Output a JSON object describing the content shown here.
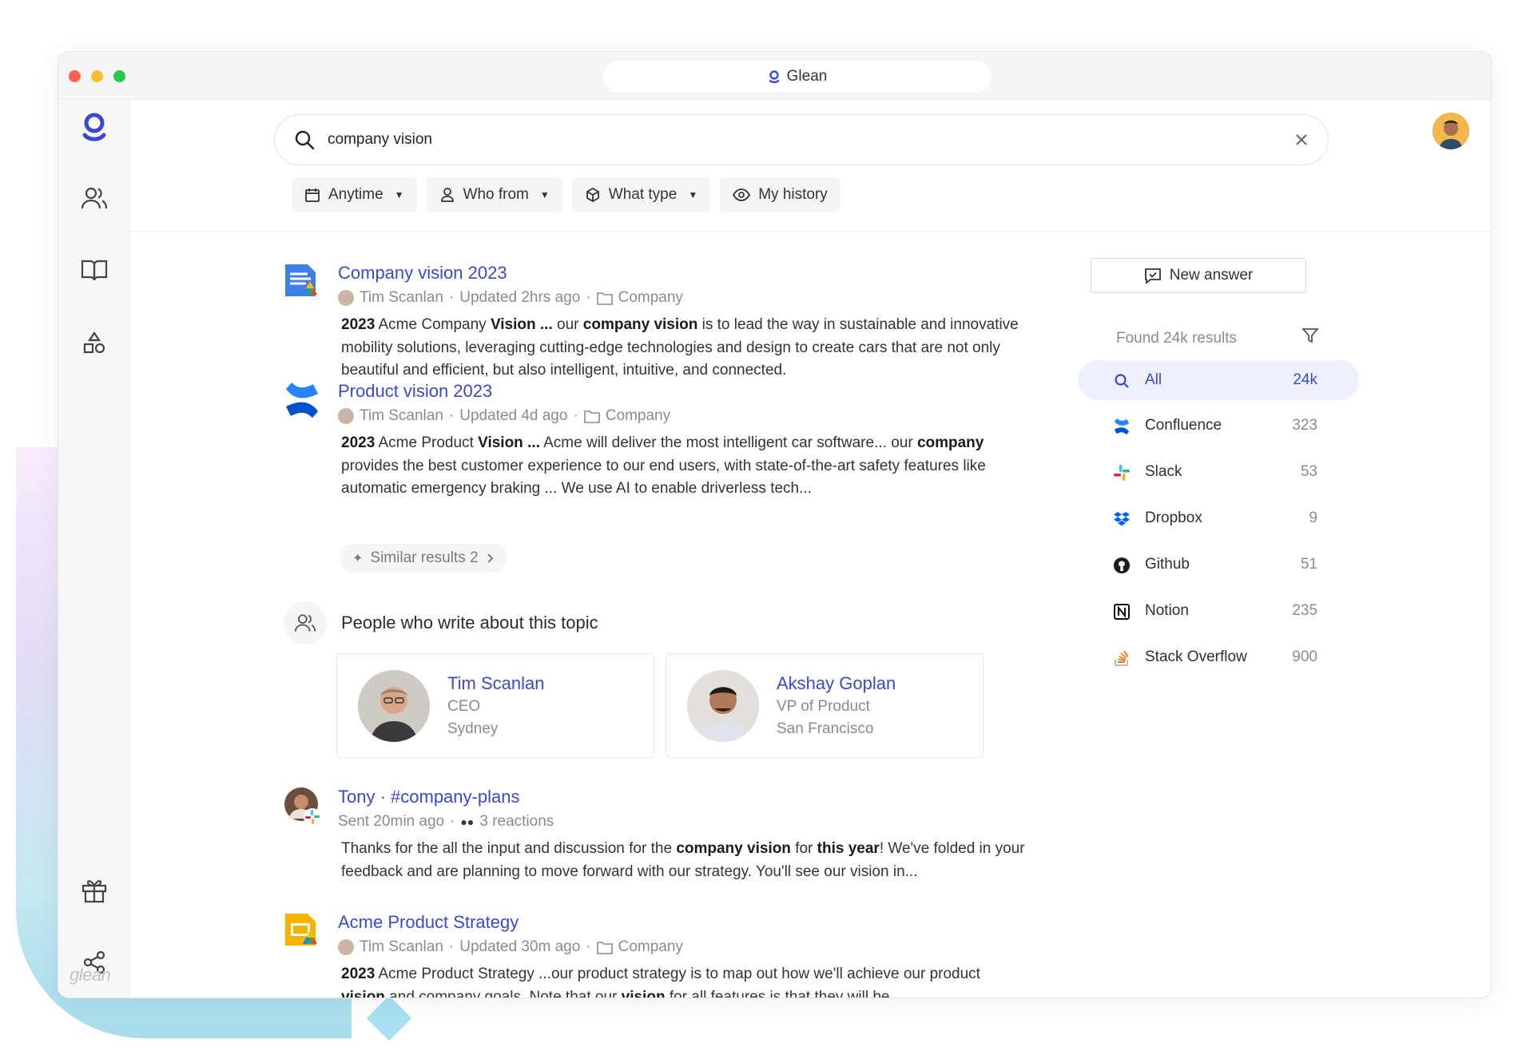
{
  "window": {
    "title": "Glean"
  },
  "rail": {
    "wordmark": "glean"
  },
  "search": {
    "query": "company vision"
  },
  "filters": [
    {
      "label": "Anytime",
      "icon": "calendar-icon"
    },
    {
      "label": "Who from",
      "icon": "person-icon"
    },
    {
      "label": "What type",
      "icon": "cube-icon"
    },
    {
      "label": "My history",
      "icon": "eye-icon"
    }
  ],
  "results": [
    {
      "title": "Company vision 2023",
      "author": "Tim Scanlan",
      "sep": "·",
      "updated": "Updated 2hrs ago",
      "sep2": "·",
      "folder": "Company",
      "snippet_html": "<b>2023</b> Acme Company <b>Vision ...</b> our <b>company vision</b> is to lead the way in sustainable and innovative mobility solutions, leveraging cutting-edge technologies and design to create cars that are not only beautiful and efficient, but also intelligent, intuitive, and connected."
    },
    {
      "title": "Product vision 2023",
      "author": "Tim Scanlan",
      "sep": "·",
      "updated": "Updated 4d ago",
      "sep2": "·",
      "folder": "Company",
      "snippet_html": "<b>2023</b> Acme Product <b>Vision ...</b> Acme will deliver the most intelligent car software... our <b>company</b> provides the best customer experience to our end users, with state-of-the-art safety features like automatic emergency braking ... We use AI to enable driverless tech..."
    },
    {
      "title": "Tony · #company-plans",
      "sent": "Sent 20min ago",
      "sep": "·",
      "reactions": "3 reactions",
      "snippet_html": "Thanks for the all the input and discussion for the <b>company vision</b> for <b>this year</b>! We've folded in your feedback and are planning to move forward with our strategy. You'll see our vision in..."
    },
    {
      "title": "Acme Product Strategy",
      "author": "Tim Scanlan",
      "sep": "·",
      "updated": "Updated 30m ago",
      "sep2": "·",
      "folder": "Company",
      "snippet_html": "<b>2023</b> Acme Product Strategy ...our product strategy is to map out how we'll achieve our product <b>vision</b> and company goals. Note that our <b>vision</b> for all features is that they will be"
    }
  ],
  "similar": {
    "label": "Similar results 2"
  },
  "people": {
    "heading": "People who write about this topic",
    "cards": [
      {
        "name": "Tim Scanlan",
        "role": "CEO",
        "location": "Sydney"
      },
      {
        "name": "Akshay Goplan",
        "role": "VP of Product",
        "location": "San Francisco"
      }
    ]
  },
  "sidebar": {
    "new_answer": "New answer",
    "found": "Found 24k results",
    "facets": [
      {
        "label": "All",
        "count": "24k",
        "icon": "search-icon",
        "selected": true
      },
      {
        "label": "Confluence",
        "count": "323",
        "icon": "confluence-icon"
      },
      {
        "label": "Slack",
        "count": "53",
        "icon": "slack-icon"
      },
      {
        "label": "Dropbox",
        "count": "9",
        "icon": "dropbox-icon"
      },
      {
        "label": "Github",
        "count": "51",
        "icon": "github-icon"
      },
      {
        "label": "Notion",
        "count": "235",
        "icon": "notion-icon"
      },
      {
        "label": "Stack Overflow",
        "count": "900",
        "icon": "stackoverflow-icon"
      }
    ]
  },
  "colors": {
    "accent": "#3a49cf",
    "selected_bg": "#eef0fd"
  }
}
